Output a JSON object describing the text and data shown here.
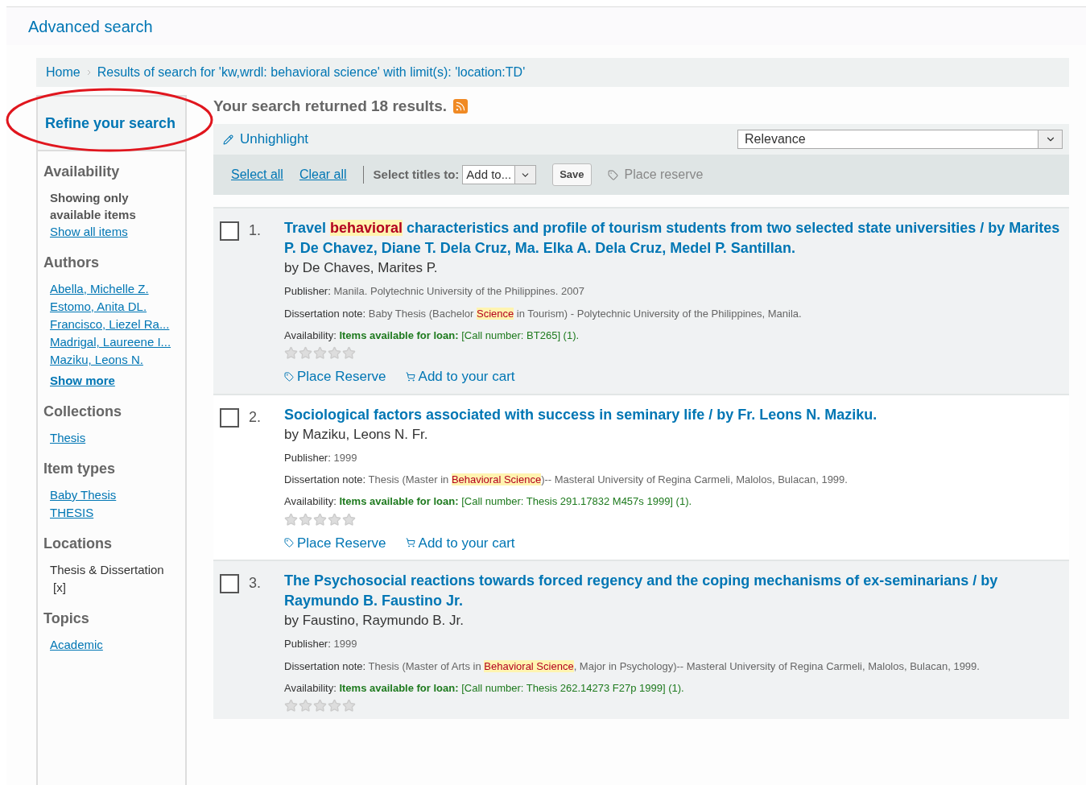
{
  "header": {
    "link": "Advanced search"
  },
  "breadcrumb": [
    "Home",
    "Results of search for 'kw,wrdl: behavioral science' with limit(s): 'location:TD'"
  ],
  "sidebar": {
    "title": "Refine your search",
    "sections": [
      {
        "heading": "Availability",
        "items": [
          {
            "text": "Showing only available items",
            "kind": "note"
          },
          {
            "text": "Show all items",
            "kind": "link"
          }
        ]
      },
      {
        "heading": "Authors",
        "items": [
          {
            "text": "Abella, Michelle Z.",
            "kind": "link"
          },
          {
            "text": "Estomo, Anita DL.",
            "kind": "link"
          },
          {
            "text": "Francisco, Liezel Ra...",
            "kind": "link"
          },
          {
            "text": "Madrigal, Laureene I...",
            "kind": "link"
          },
          {
            "text": "Maziku, Leons N.",
            "kind": "link"
          },
          {
            "text": "Show more",
            "kind": "more"
          }
        ]
      },
      {
        "heading": "Collections",
        "items": [
          {
            "text": "Thesis",
            "kind": "link"
          }
        ]
      },
      {
        "heading": "Item types",
        "items": [
          {
            "text": "Baby Thesis",
            "kind": "link"
          },
          {
            "text": "THESIS",
            "kind": "link"
          }
        ]
      },
      {
        "heading": "Locations",
        "items": [
          {
            "text": "Thesis & Dissertation",
            "kind": "selected",
            "remove": "[x]"
          }
        ]
      },
      {
        "heading": "Topics",
        "items": [
          {
            "text": "Academic",
            "kind": "link"
          }
        ]
      }
    ]
  },
  "summary": "Your search returned 18 results.",
  "toolbar": {
    "unhighlight": "Unhighlight",
    "sort": "Relevance",
    "select_all": "Select all",
    "clear_all": "Clear all",
    "select_titles_label": "Select titles to:",
    "add_to": "Add to...",
    "save": "Save",
    "place_reserve": "Place reserve"
  },
  "results": [
    {
      "number": "1.",
      "checked": false,
      "title": [
        {
          "text": "Travel ",
          "highlight": false
        },
        {
          "text": "behavioral",
          "highlight": true
        },
        {
          "text": " characteristics and profile of tourism students from two selected state universities / by Marites P. De Chavez, Diane T. Dela Cruz, Ma. Elka A. Dela Cruz, Medel P. Santillan.",
          "highlight": false
        }
      ],
      "author": "by De Chaves, Marites P.",
      "publisher_label": "Publisher:",
      "publisher": "Manila. Polytechnic University of the Philippines. 2007",
      "note_label": "Dissertation note:",
      "note": [
        {
          "text": "Baby Thesis (Bachelor ",
          "highlight": false
        },
        {
          "text": "Science",
          "highlight": true
        },
        {
          "text": " in Tourism) - Polytechnic University of the Philippines, Manila.",
          "highlight": false
        }
      ],
      "availability_label": "Availability:",
      "availability_status": "Items available for loan:",
      "call_number": "[Call number: BT265] (1).",
      "stars": 0,
      "actions": [
        "Place Reserve",
        "Add to your cart"
      ]
    },
    {
      "number": "2.",
      "checked": false,
      "title": [
        {
          "text": "Sociological factors associated with success in seminary life / by Fr. Leons N. Maziku.",
          "highlight": false
        }
      ],
      "author": "by Maziku, Leons N. Fr.",
      "publisher_label": "Publisher:",
      "publisher": "1999",
      "note_label": "Dissertation note:",
      "note": [
        {
          "text": "Thesis (Master in ",
          "highlight": false
        },
        {
          "text": "Behavioral Science",
          "highlight": true
        },
        {
          "text": ")-- Masteral University of Regina Carmeli, Malolos, Bulacan, 1999.",
          "highlight": false
        }
      ],
      "availability_label": "Availability:",
      "availability_status": "Items available for loan:",
      "call_number": "[Call number: Thesis 291.17832 M457s 1999] (1).",
      "stars": 0,
      "actions": [
        "Place Reserve",
        "Add to your cart"
      ]
    },
    {
      "number": "3.",
      "checked": false,
      "title": [
        {
          "text": "The Psychosocial reactions towards forced regency and the coping mechanisms of ex-seminarians / by Raymundo B. Faustino Jr.",
          "highlight": false
        }
      ],
      "author": "by Faustino, Raymundo B. Jr.",
      "publisher_label": "Publisher:",
      "publisher": "1999",
      "note_label": "Dissertation note:",
      "note": [
        {
          "text": "Thesis (Master of Arts in ",
          "highlight": false
        },
        {
          "text": "Behavioral Science",
          "highlight": true
        },
        {
          "text": ", Major in Psychology)-- Masteral University of Regina Carmeli, Malolos, Bulacan, 1999.",
          "highlight": false
        }
      ],
      "availability_label": "Availability:",
      "availability_status": "Items available for loan:",
      "call_number": "[Call number: Thesis 262.14273 F27p 1999] (1).",
      "stars": 0
    }
  ]
}
